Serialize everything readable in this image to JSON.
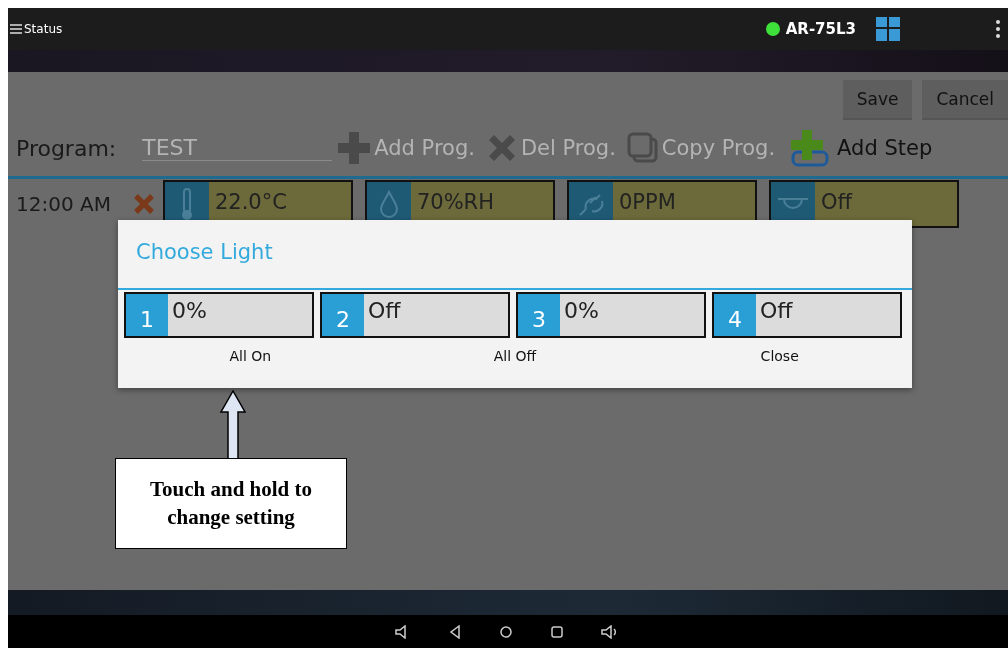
{
  "status_bar": {
    "menu_label": "Status",
    "device": "AR-75L3",
    "connected": true
  },
  "toolbar": {
    "buttons": [
      "Save",
      "Cancel"
    ]
  },
  "program": {
    "label": "Program:",
    "value": "TEST",
    "actions": [
      {
        "kind": "add",
        "label": "Add Prog.",
        "disabled": true
      },
      {
        "kind": "delete",
        "label": "Del Prog.",
        "disabled": true
      },
      {
        "kind": "copy",
        "label": "Copy Prog.",
        "disabled": true
      },
      {
        "kind": "add-step",
        "label": "Add Step",
        "disabled": false
      }
    ]
  },
  "step": {
    "time": "12:00 AM",
    "cells": [
      {
        "kind": "temperature",
        "value": "22.0°C"
      },
      {
        "kind": "humidity",
        "value": "70%RH"
      },
      {
        "kind": "co2",
        "value": "0PPM"
      },
      {
        "kind": "light",
        "value": "Off"
      }
    ]
  },
  "dialog": {
    "title": "Choose Light",
    "lights": [
      {
        "number": "1",
        "value": "0%"
      },
      {
        "number": "2",
        "value": "Off"
      },
      {
        "number": "3",
        "value": "0%"
      },
      {
        "number": "4",
        "value": "Off"
      }
    ],
    "buttons": [
      "All On",
      "All Off",
      "Close"
    ]
  },
  "annotation": {
    "text": "Touch and hold to change setting"
  }
}
